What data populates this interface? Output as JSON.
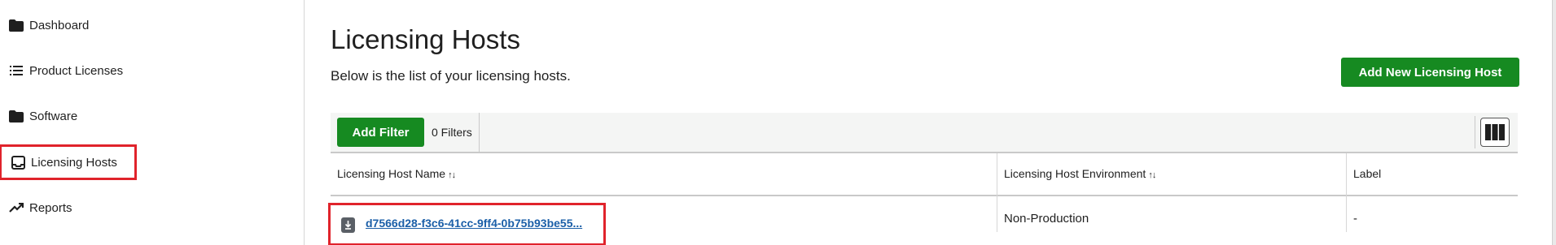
{
  "sidebar": {
    "items": [
      {
        "label": "Dashboard",
        "icon": "folder-icon"
      },
      {
        "label": "Product Licenses",
        "icon": "list-icon"
      },
      {
        "label": "Software",
        "icon": "folder-icon"
      },
      {
        "label": "Licensing Hosts",
        "icon": "inbox-icon"
      },
      {
        "label": "Reports",
        "icon": "trend-icon"
      }
    ]
  },
  "main": {
    "title": "Licensing Hosts",
    "subtitle": "Below is the list of your licensing hosts.",
    "add_host_label": "Add New Licensing Host",
    "toolbar": {
      "add_filter_label": "Add Filter",
      "filter_count": "0 Filters"
    },
    "table": {
      "columns": [
        {
          "label": "Licensing Host Name",
          "sortable": true
        },
        {
          "label": "Licensing Host Environment",
          "sortable": true
        },
        {
          "label": "Label",
          "sortable": false
        }
      ],
      "rows": [
        {
          "name": "d7566d28-f3c6-41cc-9ff4-0b75b93be55...",
          "environment": "Non-Production",
          "label": "-"
        }
      ]
    }
  },
  "colors": {
    "accent_green": "#168a21",
    "highlight_red": "#e0232b",
    "link_blue": "#1b5fa8"
  }
}
